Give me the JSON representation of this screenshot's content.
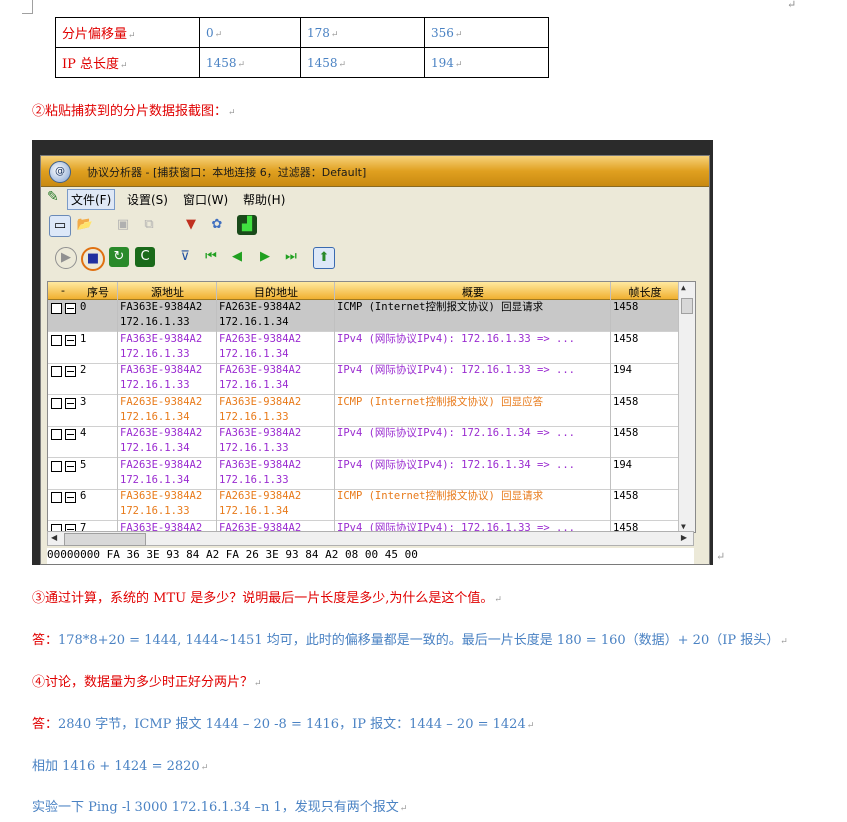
{
  "table": {
    "rows": [
      {
        "label": "分片偏移量",
        "values": [
          "0",
          "178",
          "356"
        ]
      },
      {
        "label": "IP 总长度",
        "values": [
          "1458",
          "1458",
          "194"
        ]
      }
    ]
  },
  "paragraph_mark": "↵",
  "q2": "②粘贴捕获到的分片数据报截图：",
  "window": {
    "title": "协议分析器 - [捕获窗口：本地连接 6，过滤器：Default]",
    "title_icon": "@",
    "menu": [
      "文件(F)",
      "设置(S)",
      "窗口(W)",
      "帮助(H)"
    ],
    "columns": [
      "-",
      "序号",
      "源地址",
      "目的地址",
      "概要",
      "帧长度"
    ],
    "packets": [
      {
        "no": "0",
        "src_mac": "FA363E-9384A2",
        "src_ip": "172.16.1.33",
        "dst_mac": "FA263E-9384A2",
        "dst_ip": "172.16.1.34",
        "summary": "ICMP (Internet控制报文协议) 回显请求",
        "len": "1458",
        "color": "#000000",
        "selected": true
      },
      {
        "no": "1",
        "src_mac": "FA363E-9384A2",
        "src_ip": "172.16.1.33",
        "dst_mac": "FA263E-9384A2",
        "dst_ip": "172.16.1.34",
        "summary": "IPv4 (网际协议IPv4): 172.16.1.33 => ...",
        "len": "1458",
        "color": "#9a2bd0",
        "selected": false
      },
      {
        "no": "2",
        "src_mac": "FA363E-9384A2",
        "src_ip": "172.16.1.33",
        "dst_mac": "FA263E-9384A2",
        "dst_ip": "172.16.1.34",
        "summary": "IPv4 (网际协议IPv4): 172.16.1.33 => ...",
        "len": "194",
        "color": "#9a2bd0",
        "selected": false
      },
      {
        "no": "3",
        "src_mac": "FA263E-9384A2",
        "src_ip": "172.16.1.34",
        "dst_mac": "FA363E-9384A2",
        "dst_ip": "172.16.1.33",
        "summary": "ICMP (Internet控制报文协议) 回显应答",
        "len": "1458",
        "color": "#e87a1a",
        "selected": false
      },
      {
        "no": "4",
        "src_mac": "FA263E-9384A2",
        "src_ip": "172.16.1.34",
        "dst_mac": "FA363E-9384A2",
        "dst_ip": "172.16.1.33",
        "summary": "IPv4 (网际协议IPv4): 172.16.1.34 => ...",
        "len": "1458",
        "color": "#9a2bd0",
        "selected": false
      },
      {
        "no": "5",
        "src_mac": "FA263E-9384A2",
        "src_ip": "172.16.1.34",
        "dst_mac": "FA363E-9384A2",
        "dst_ip": "172.16.1.33",
        "summary": "IPv4 (网际协议IPv4): 172.16.1.34 => ...",
        "len": "194",
        "color": "#9a2bd0",
        "selected": false
      },
      {
        "no": "6",
        "src_mac": "FA363E-9384A2",
        "src_ip": "172.16.1.33",
        "dst_mac": "FA263E-9384A2",
        "dst_ip": "172.16.1.34",
        "summary": "ICMP (Internet控制报文协议) 回显请求",
        "len": "1458",
        "color": "#e87a1a",
        "selected": false
      },
      {
        "no": "7",
        "src_mac": "FA363E-9384A2",
        "src_ip": "",
        "dst_mac": "FA263E-9384A2",
        "dst_ip": "",
        "summary": "IPv4 (网际协议IPv4): 172.16.1.33 => ...",
        "len": "1458",
        "color": "#9a2bd0",
        "selected": false
      }
    ],
    "bottom_text": "00000000  FA 36 3E 93 84 A2 FA 26 3E 93 84 A2 08 00  45 00"
  },
  "q3": "③通过计算，系统的 MTU 是多少？说明最后一片长度是多少,为什么是这个值。",
  "a3_prefix": "答：",
  "a3": "178*8+20 = 1444, 1444~1451 均可，此时的偏移量都是一致的。最后一片长度是 180 = 160（数据）+ 20（IP 报头）",
  "q4": "④讨论，数据量为多少时正好分两片？",
  "a4_prefix": "答：",
  "a4": "2840 字节，ICMP 报文 1444 – 20 -8 = 1416，IP 报文：1444 – 20 = 1424",
  "sum_line": "相加 1416 + 1424 = 2820",
  "experiment_line": "实验一下 Ping -l 3000 172.16.1.34 –n 1，发现只有两个报文"
}
